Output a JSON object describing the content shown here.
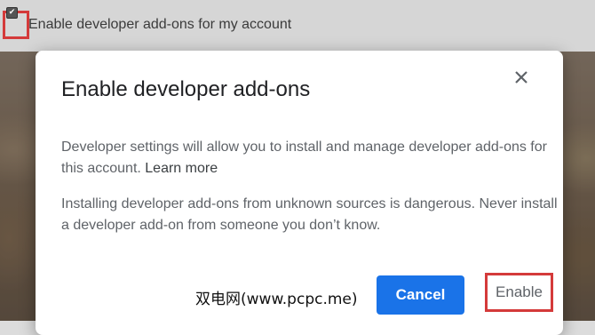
{
  "background": {
    "checkbox_label": "Enable developer add-ons for my account",
    "checkbox_checked": true,
    "highlight_color": "#d43a3a"
  },
  "dialog": {
    "title": "Enable developer add-ons",
    "body1": "Developer settings will allow you to install and manage developer add-ons for this account.",
    "learn_more": "Learn more",
    "body2": "Installing developer add-ons from unknown sources is dangerous. Never install a developer add-on from someone you don’t know.",
    "close_icon": "close-icon",
    "cancel_label": "Cancel",
    "enable_label": "Enable",
    "accent_color": "#1a73e8"
  },
  "watermark": "双电网(www.pcpc.me)"
}
